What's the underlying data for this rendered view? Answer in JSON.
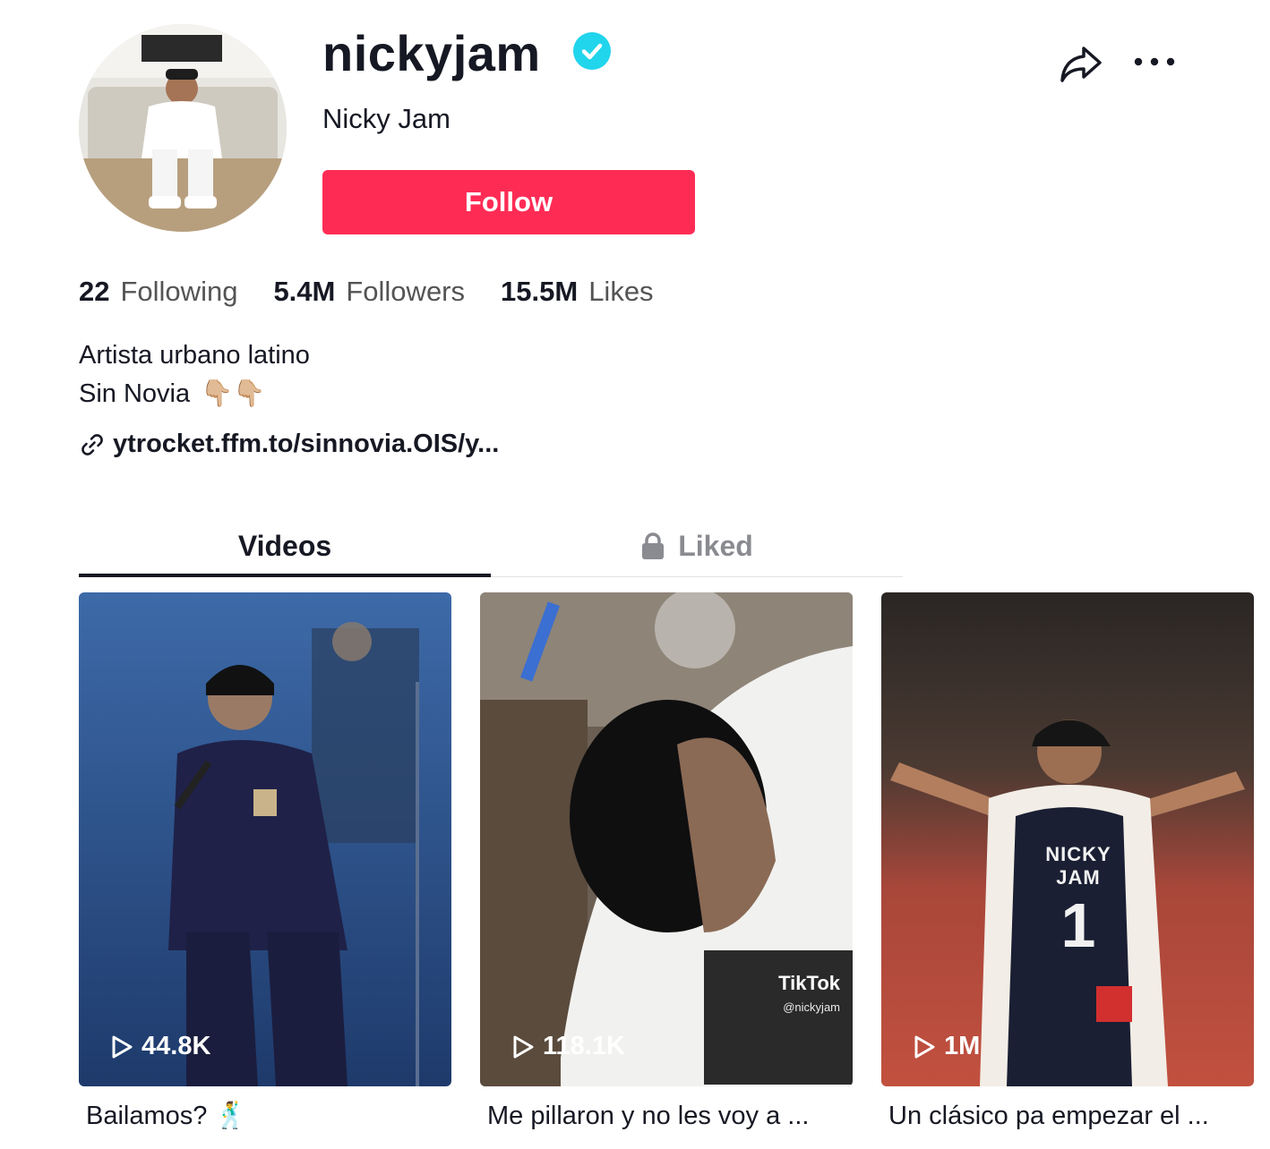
{
  "profile": {
    "username": "nickyjam",
    "display_name": "Nicky Jam",
    "follow_label": "Follow",
    "verified": true
  },
  "stats": [
    {
      "value": "22",
      "label": "Following"
    },
    {
      "value": "5.4M",
      "label": "Followers"
    },
    {
      "value": "15.5M",
      "label": "Likes"
    }
  ],
  "bio": {
    "line1": "Artista urbano latino",
    "line2": "Sin Novia",
    "emoji": "👇🏼👇🏼"
  },
  "link": {
    "text": "ytrocket.ffm.to/sinnovia.OIS/y..."
  },
  "tabs": {
    "videos": "Videos",
    "liked": "Liked"
  },
  "videos": [
    {
      "views": "44.8K",
      "caption": "Bailamos? 🕺"
    },
    {
      "views": "118.1K",
      "caption": "Me pillaron y no les voy a ...",
      "watermark_brand": "TikTok",
      "watermark_handle": "@nickyjam"
    },
    {
      "views": "1M",
      "caption": "Un clásico pa empezar el ...",
      "jersey_name": "NICKY JAM",
      "jersey_number": "1"
    }
  ],
  "colors": {
    "accent": "#fe2c55",
    "verified": "#20d5ec",
    "text": "#161823",
    "muted": "#8a8b91"
  },
  "icons": [
    "verified-badge-icon",
    "share-icon",
    "more-icon",
    "link-icon",
    "lock-icon",
    "play-icon"
  ]
}
